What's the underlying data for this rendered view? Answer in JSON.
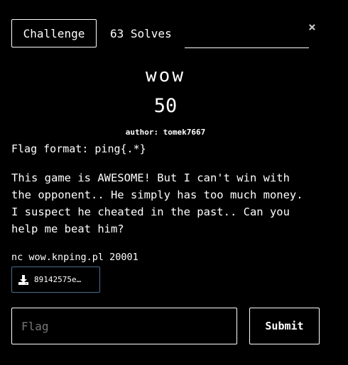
{
  "tabs": {
    "challenge_label": "Challenge",
    "solves_label": "63 Solves"
  },
  "close_glyph": "×",
  "challenge": {
    "name": "wow",
    "points": "50",
    "author": "author: tomek7667",
    "flag_format": "Flag format: ping{.*}",
    "description": "This game is AWESOME! But I can't win with\nthe opponent.. He simply has too much money.\nI suspect he cheated in the past.. Can you\nhelp me beat him?",
    "connection": "nc wow.knping.pl 20001",
    "file_label": "89142575e…"
  },
  "form": {
    "flag_placeholder": "Flag",
    "flag_value": "",
    "submit_label": "Submit"
  },
  "colors": {
    "background": "#000000",
    "text": "#ffffff",
    "file_border": "#4a6e8c"
  },
  "icons": {
    "close": "close-icon",
    "download": "download-icon"
  }
}
